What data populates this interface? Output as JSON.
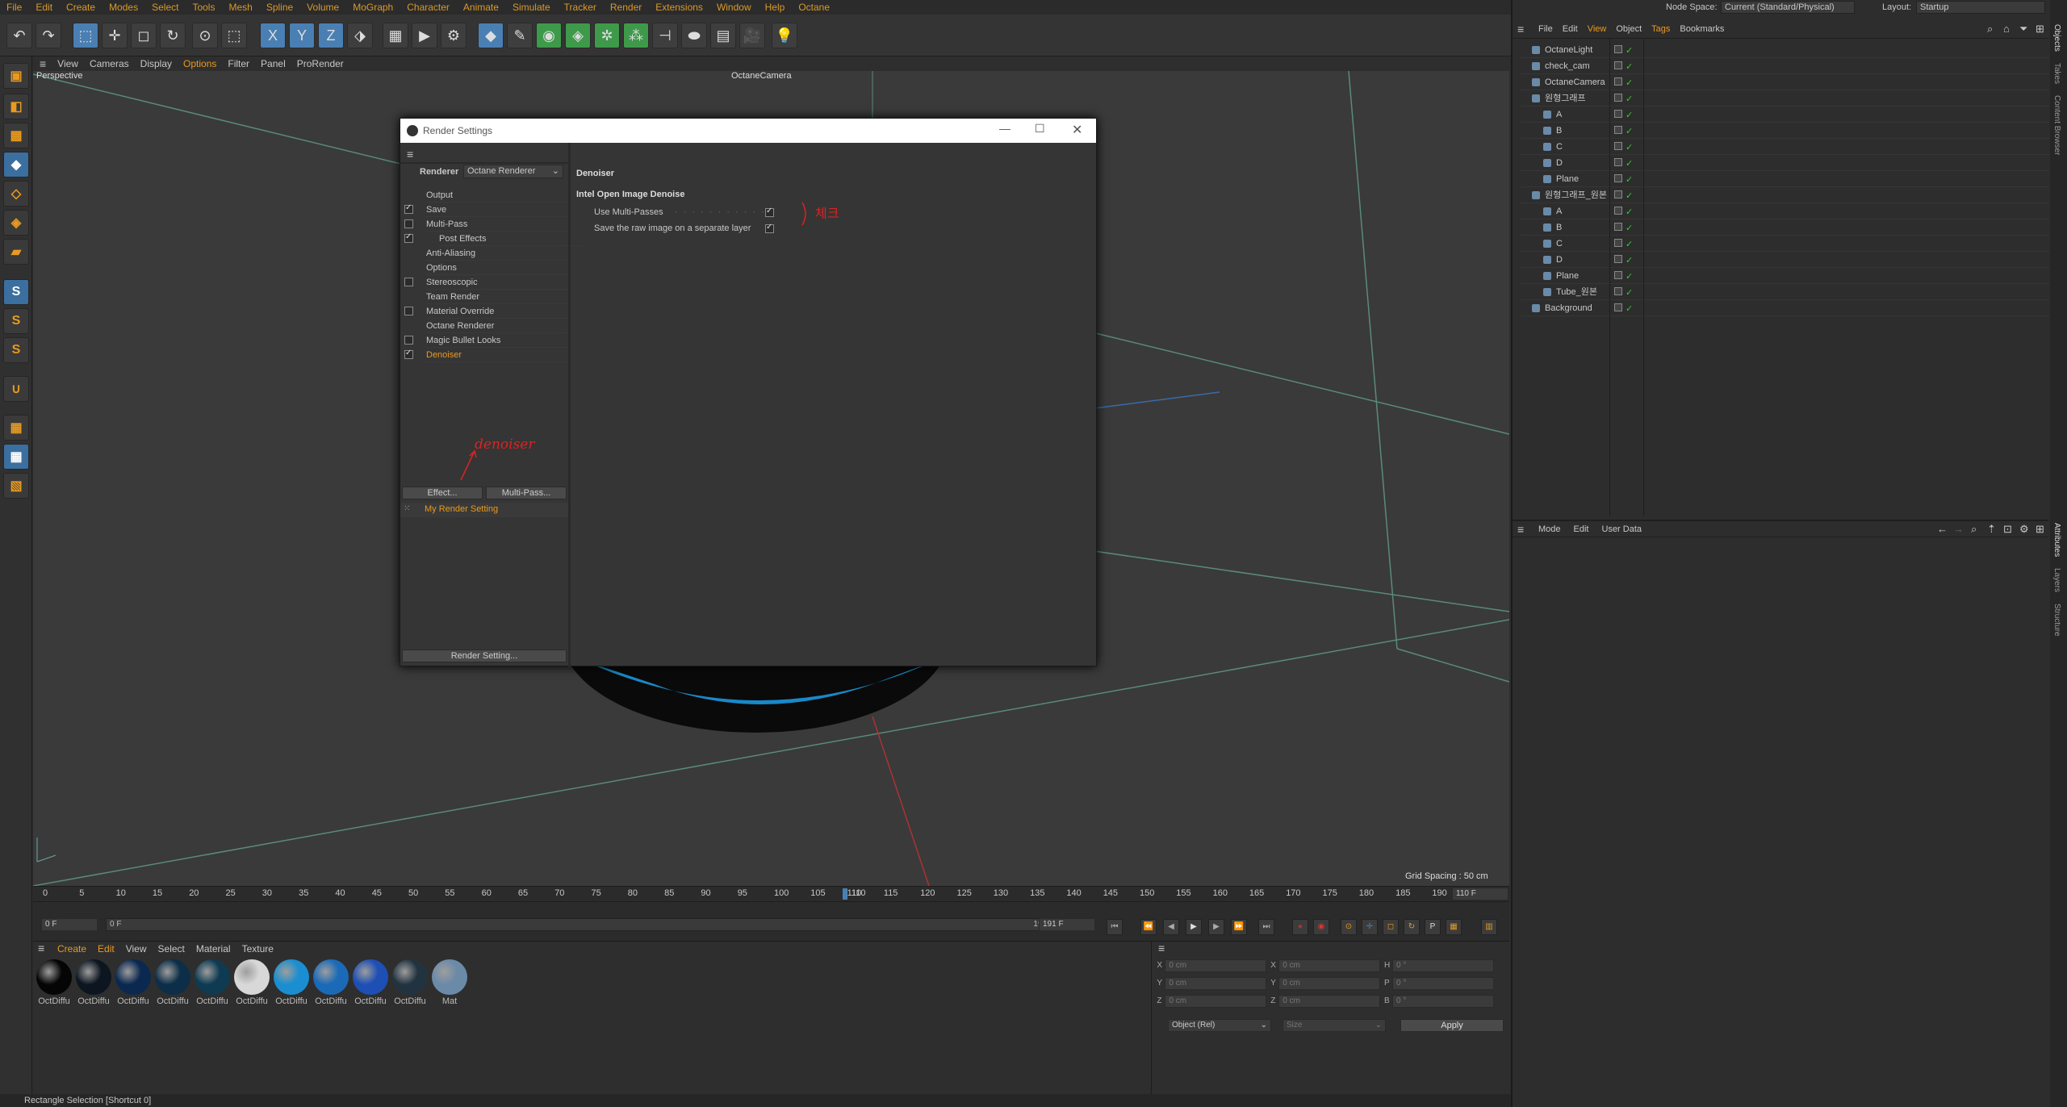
{
  "menubar": {
    "items": [
      "File",
      "Edit",
      "Create",
      "Modes",
      "Select",
      "Tools",
      "Mesh",
      "Spline",
      "Volume",
      "MoGraph",
      "Character",
      "Animate",
      "Simulate",
      "Tracker",
      "Render",
      "Extensions",
      "Window",
      "Help",
      "Octane"
    ]
  },
  "node_space": {
    "label": "Node Space:",
    "value": "Current (Standard/Physical)"
  },
  "layout": {
    "label": "Layout:",
    "value": "Startup"
  },
  "viewport": {
    "menu": [
      "View",
      "Cameras",
      "Display",
      "Options",
      "Filter",
      "Panel",
      "ProRender"
    ],
    "name": "Perspective",
    "camera": "OctaneCamera",
    "grid_spacing": "Grid Spacing : 50 cm"
  },
  "dialog": {
    "title": "Render Settings",
    "renderer_label": "Renderer",
    "renderer_value": "Octane Renderer",
    "tree": [
      {
        "label": "Output",
        "check": "none"
      },
      {
        "label": "Save",
        "check": "on"
      },
      {
        "label": "Multi-Pass",
        "check": "off"
      },
      {
        "label": "Post Effects",
        "check": "on"
      },
      {
        "label": "Anti-Aliasing",
        "check": "none"
      },
      {
        "label": "Options",
        "check": "none"
      },
      {
        "label": "Stereoscopic",
        "check": "off"
      },
      {
        "label": "Team Render",
        "check": "none"
      },
      {
        "label": "Material Override",
        "check": "off"
      },
      {
        "label": "Octane Renderer",
        "check": "none"
      },
      {
        "label": "Magic Bullet Looks",
        "check": "off"
      },
      {
        "label": "Denoiser",
        "check": "on"
      }
    ],
    "effect_btn": "Effect...",
    "multipass_btn": "Multi-Pass...",
    "preset": "My Render Setting",
    "render_setting_btn": "Render Setting...",
    "section_title": "Denoiser",
    "subsection": "Intel Open Image Denoise",
    "option1": "Use Multi-Passes",
    "option2": "Save the raw image on a separate layer",
    "annotation_left": "denoiser",
    "annotation_right": "체크"
  },
  "timeline": {
    "ticks": [
      "0",
      "5",
      "10",
      "15",
      "20",
      "25",
      "30",
      "35",
      "40",
      "45",
      "50",
      "55",
      "60",
      "65",
      "70",
      "75",
      "80",
      "85",
      "90",
      "95",
      "100",
      "105",
      "110",
      "115",
      "120",
      "125",
      "130",
      "135",
      "140",
      "145",
      "150",
      "155",
      "160",
      "165",
      "170",
      "175",
      "180",
      "185",
      "190"
    ],
    "current_frame": "110",
    "end_field": "110 F",
    "start": "0 F",
    "start2": "0 F",
    "end": "191 F",
    "end2": "191 F"
  },
  "material_manager": {
    "menu": [
      "Create",
      "Edit",
      "View",
      "Select",
      "Material",
      "Texture"
    ],
    "materials": [
      {
        "label": "OctDiffu",
        "color": "#050505"
      },
      {
        "label": "OctDiffu",
        "color": "#0d1620"
      },
      {
        "label": "OctDiffu",
        "color": "#0b2850"
      },
      {
        "label": "OctDiffu",
        "color": "#0c2e48"
      },
      {
        "label": "OctDiffu",
        "color": "#0e3a52"
      },
      {
        "label": "OctDiffu",
        "color": "#d8d8d8"
      },
      {
        "label": "OctDiffu",
        "color": "#1a8ed0"
      },
      {
        "label": "OctDiffu",
        "color": "#1a6ab8"
      },
      {
        "label": "OctDiffu",
        "color": "#1d4fb5"
      },
      {
        "label": "OctDiffu",
        "color": "#223340"
      },
      {
        "label": "Mat",
        "color": "#6a8aa8"
      }
    ]
  },
  "coords": {
    "rows": [
      {
        "a": "X",
        "av": "0 cm",
        "b": "X",
        "bv": "0 cm",
        "c": "H",
        "cv": "0 °"
      },
      {
        "a": "Y",
        "av": "0 cm",
        "b": "Y",
        "bv": "0 cm",
        "c": "P",
        "cv": "0 °"
      },
      {
        "a": "Z",
        "av": "0 cm",
        "b": "Z",
        "bv": "0 cm",
        "c": "B",
        "cv": "0 °"
      }
    ],
    "mode": "Object (Rel)",
    "size": "Size",
    "apply": "Apply"
  },
  "status": "Rectangle Selection [Shortcut 0]",
  "object_manager": {
    "menu": [
      "File",
      "Edit",
      "View",
      "Object",
      "Tags",
      "Bookmarks"
    ],
    "objects": [
      {
        "name": "OctaneLight",
        "indent": 0
      },
      {
        "name": "check_cam",
        "indent": 0
      },
      {
        "name": "OctaneCamera",
        "indent": 0
      },
      {
        "name": "원형그래프",
        "indent": 0
      },
      {
        "name": "A",
        "indent": 1
      },
      {
        "name": "B",
        "indent": 1
      },
      {
        "name": "C",
        "indent": 1
      },
      {
        "name": "D",
        "indent": 1
      },
      {
        "name": "Plane",
        "indent": 1
      },
      {
        "name": "원형그래프_원본",
        "indent": 0
      },
      {
        "name": "A",
        "indent": 1
      },
      {
        "name": "B",
        "indent": 1
      },
      {
        "name": "C",
        "indent": 1
      },
      {
        "name": "D",
        "indent": 1
      },
      {
        "name": "Plane",
        "indent": 1
      },
      {
        "name": "Tube_원본",
        "indent": 1
      },
      {
        "name": "Background",
        "indent": 0
      }
    ]
  },
  "attributes": {
    "menu": [
      "Mode",
      "Edit",
      "User Data"
    ]
  },
  "side_tabs_top": [
    "Objects",
    "Takes",
    "Content Browser"
  ],
  "side_tabs_bottom": [
    "Attributes",
    "Layers",
    "Structure"
  ]
}
